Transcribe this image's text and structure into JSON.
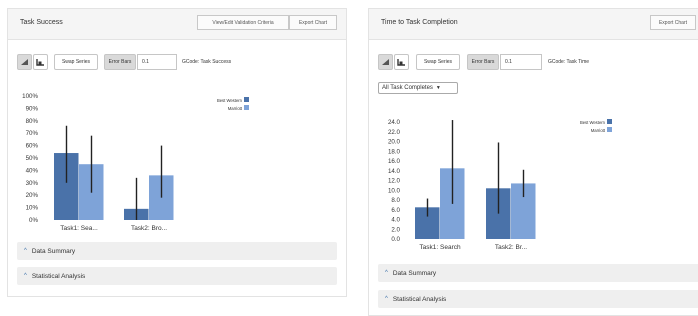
{
  "colors": {
    "series1": "#4a72a9",
    "series2": "#7ea3d8",
    "errorbar": "#222222",
    "accordion_bg": "#efefef",
    "header_bg": "#f5f5f5"
  },
  "left": {
    "title": "Task Success",
    "header_buttons": [
      "View/Edit Validation Criteria",
      "Export Chart"
    ],
    "toolbar": {
      "icon1": "bar-chart-icon",
      "icon2": "axis-chart-icon",
      "swap_label": "Swap Series",
      "error_bars_label": "Error Bars",
      "error_value": "0.1",
      "gcode_label": "GCode: Task Success"
    },
    "accordions": [
      "Data Summary",
      "Statistical Analysis"
    ],
    "chart_data": {
      "type": "bar",
      "categories": [
        "Task1: Sea...",
        "Task2: Bro..."
      ],
      "y_tick_labels": [
        "0%",
        "10%",
        "20%",
        "30%",
        "40%",
        "50%",
        "60%",
        "70%",
        "80%",
        "90%",
        "100%"
      ],
      "ylim": [
        0,
        100
      ],
      "series": [
        {
          "name": "Best Western",
          "values": [
            54,
            9
          ],
          "err_low": [
            30,
            0
          ],
          "err_high": [
            76,
            34
          ]
        },
        {
          "name": "Marriott",
          "values": [
            45,
            36
          ],
          "err_low": [
            22,
            18
          ],
          "err_high": [
            68,
            60
          ]
        }
      ],
      "legend_position": "top-right"
    }
  },
  "right": {
    "title": "Time to Task Completion",
    "header_buttons": [
      "Export Chart"
    ],
    "toolbar": {
      "icon1": "bar-chart-icon",
      "icon2": "axis-chart-icon",
      "swap_label": "Swap Series",
      "error_bars_label": "Error Bars",
      "error_value": "0.1",
      "gcode_label": "GCode: Task Time"
    },
    "filter_select": "All Task Completes",
    "accordions": [
      "Data Summary",
      "Statistical Analysis"
    ],
    "chart_data": {
      "type": "bar",
      "categories": [
        "Task1: Search",
        "Task2: Br..."
      ],
      "y_tick_labels": [
        "0.0",
        "2.0",
        "4.0",
        "6.0",
        "8.0",
        "10.0",
        "12.0",
        "14.0",
        "16.0",
        "18.0",
        "20.0",
        "22.0",
        "24.0"
      ],
      "ylim": [
        0,
        24
      ],
      "series": [
        {
          "name": "Best Western",
          "values": [
            6.5,
            10.4
          ],
          "err_low": [
            4.6,
            5.2
          ],
          "err_high": [
            8.3,
            19.8
          ]
        },
        {
          "name": "Marriott",
          "values": [
            14.5,
            11.4
          ],
          "err_low": [
            7.2,
            8.6
          ],
          "err_high": [
            24.4,
            14.2
          ]
        }
      ],
      "legend_position": "top-right"
    }
  }
}
